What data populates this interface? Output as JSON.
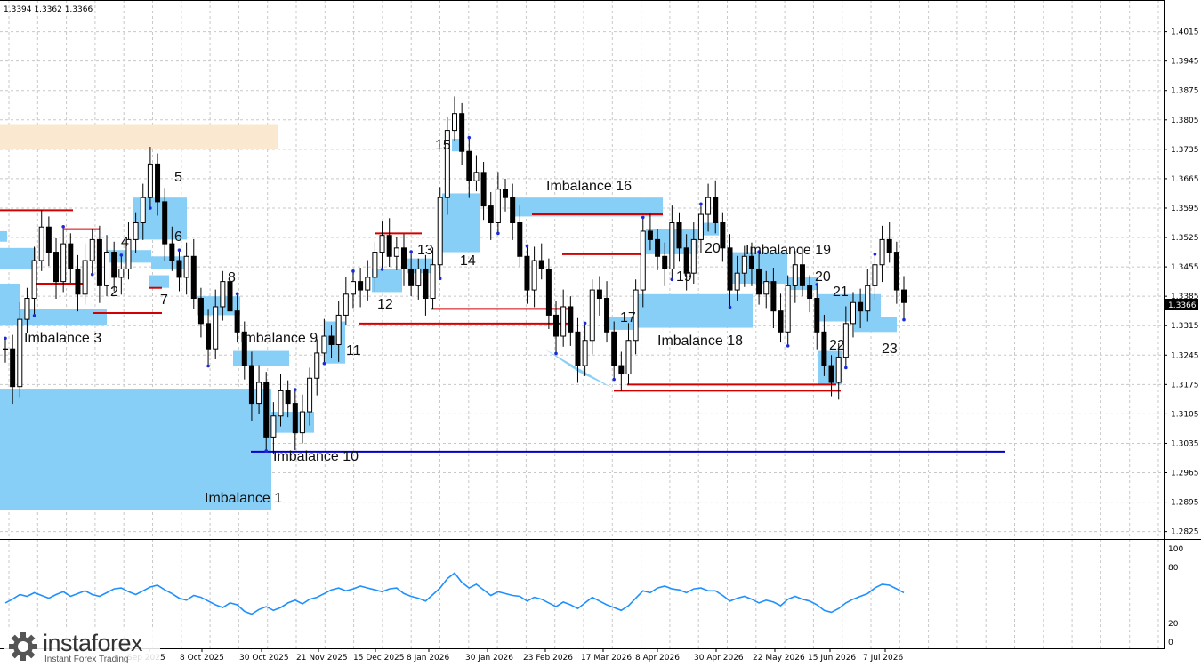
{
  "header": {
    "ohlc": "1.3394 1.3362 1.3366"
  },
  "brand": {
    "name": "instaforex",
    "tagline": "Instant Forex Trading"
  },
  "colors": {
    "imbalance_zone": "#88cff7",
    "supply_zone": "#fbe8d1",
    "level_red": "#d40000",
    "level_blue": "#0000cc",
    "candle": "#000000",
    "marker": "#1a2ad8",
    "indicator": "#1e90ff",
    "current_price_tag": "#000000"
  },
  "chart_data": [
    {
      "type": "candlestick",
      "title": "",
      "symbol": "",
      "ylim": [
        1.282,
        1.4065
      ],
      "y_ticks": [
        "1.4015",
        "1.3945",
        "1.3875",
        "1.3805",
        "1.3735",
        "1.3665",
        "1.3595",
        "1.3525",
        "1.3455",
        "1.3385",
        "1.3315",
        "1.3245",
        "1.3175",
        "1.3105",
        "1.3035",
        "1.2965",
        "1.2895",
        "1.2825"
      ],
      "x_ticks": [
        "Sep 2025",
        "8 Oct 2025",
        "30 Oct 2025",
        "21 Nov 2025",
        "15 Dec 2025",
        "8 Jan 2026",
        "30 Jan 2026",
        "23 Feb 2026",
        "17 Mar 2026",
        "8 Apr 2026",
        "30 Apr 2026",
        "22 May 2026",
        "15 Jun 2026",
        "7 Jul 2026"
      ],
      "current_price": "1.3366",
      "close_path": [
        1.326,
        1.317,
        1.333,
        1.338,
        1.347,
        1.355,
        1.349,
        1.342,
        1.351,
        1.345,
        1.339,
        1.347,
        1.352,
        1.341,
        1.349,
        1.343,
        1.345,
        1.352,
        1.356,
        1.362,
        1.37,
        1.361,
        1.351,
        1.347,
        1.343,
        1.348,
        1.338,
        1.332,
        1.326,
        1.336,
        1.342,
        1.335,
        1.33,
        1.322,
        1.313,
        1.318,
        1.305,
        1.31,
        1.316,
        1.313,
        1.306,
        1.311,
        1.319,
        1.325,
        1.329,
        1.327,
        1.334,
        1.339,
        1.342,
        1.34,
        1.343,
        1.349,
        1.353,
        1.348,
        1.35,
        1.345,
        1.341,
        1.345,
        1.338,
        1.346,
        1.362,
        1.378,
        1.382,
        1.373,
        1.366,
        1.368,
        1.36,
        1.356,
        1.364,
        1.362,
        1.356,
        1.348,
        1.34,
        1.347,
        1.345,
        1.334,
        1.329,
        1.336,
        1.33,
        1.322,
        1.328,
        1.34,
        1.338,
        1.33,
        1.322,
        1.32,
        1.328,
        1.34,
        1.354,
        1.352,
        1.348,
        1.345,
        1.356,
        1.35,
        1.344,
        1.352,
        1.358,
        1.362,
        1.356,
        1.35,
        1.34,
        1.344,
        1.348,
        1.345,
        1.339,
        1.342,
        1.335,
        1.33,
        1.341,
        1.346,
        1.341,
        1.338,
        1.33,
        1.322,
        1.318,
        1.324,
        1.332,
        1.337,
        1.335,
        1.341,
        1.346,
        1.352,
        1.349,
        1.34,
        1.337
      ],
      "zones": [
        {
          "label": "Imbalance 1",
          "low": 1.2875,
          "high": 1.3165,
          "start": "",
          "end": "30 Oct 2025"
        },
        {
          "label": "2",
          "low": 1.3355,
          "high": 1.3415,
          "start": "",
          "end": ""
        },
        {
          "label": "Imbalance 3",
          "low": 1.3315,
          "high": 1.3355,
          "start": "",
          "end": ""
        },
        {
          "label": "4",
          "low": 1.3465,
          "high": 1.3495,
          "start": "",
          "end": ""
        },
        {
          "label": "5",
          "low": 1.352,
          "high": 1.362,
          "start": "",
          "end": "8 Oct 2025"
        },
        {
          "label": "6",
          "low": 1.345,
          "high": 1.348,
          "start": "",
          "end": "8 Oct 2025"
        },
        {
          "label": "7",
          "low": 1.3405,
          "high": 1.3435,
          "start": "",
          "end": ""
        },
        {
          "label": "8",
          "low": 1.334,
          "high": 1.3385,
          "start": "8 Oct 2025",
          "end": ""
        },
        {
          "label": "Imbalance 9",
          "low": 1.322,
          "high": 1.3255,
          "start": "30 Oct 2025",
          "end": "21 Nov 2025"
        },
        {
          "label": "Imbalance 10",
          "low": 1.306,
          "high": 1.311,
          "start": "30 Oct 2025",
          "end": "21 Nov 2025"
        },
        {
          "label": "11",
          "low": 1.3225,
          "high": 1.3325,
          "start": "21 Nov 2025",
          "end": ""
        },
        {
          "label": "12",
          "low": 1.3395,
          "high": 1.345,
          "start": "15 Dec 2025",
          "end": ""
        },
        {
          "label": "13",
          "low": 1.344,
          "high": 1.3475,
          "start": "8 Jan 2026",
          "end": ""
        },
        {
          "label": "14",
          "low": 1.349,
          "high": 1.363,
          "start": "",
          "end": "30 Jan 2026"
        },
        {
          "label": "15",
          "low": 1.373,
          "high": 1.376,
          "start": "",
          "end": ""
        },
        {
          "label": "Imbalance 16",
          "low": 1.3575,
          "high": 1.362,
          "start": "",
          "end": "8 Apr 2026"
        },
        {
          "label": "17",
          "low": 1.3305,
          "high": 1.3335,
          "start": "",
          "end": ""
        },
        {
          "label": "Imbalance 18",
          "low": 1.331,
          "high": 1.339,
          "start": "8 Apr 2026",
          "end": "22 May 2026"
        },
        {
          "label": "19",
          "low": 1.3485,
          "high": 1.3545,
          "start": "8 Apr 2026",
          "end": ""
        },
        {
          "label": "Imbalance 19",
          "low": 1.3415,
          "high": 1.349,
          "start": "22 May 2026",
          "end": ""
        },
        {
          "label": "20",
          "low": 1.353,
          "high": 1.356,
          "start": "",
          "end": ""
        },
        {
          "label": "20",
          "low": 1.34,
          "high": 1.343,
          "start": "",
          "end": ""
        },
        {
          "label": "21",
          "low": 1.3325,
          "high": 1.339,
          "start": "15 Jun 2026",
          "end": ""
        },
        {
          "label": "22",
          "low": 1.3175,
          "high": 1.3255,
          "start": "15 Jun 2026",
          "end": ""
        },
        {
          "label": "23",
          "low": 1.33,
          "high": 1.3335,
          "start": "",
          "end": "7 Jul 2026"
        }
      ],
      "supply_zone": {
        "low": 1.3735,
        "high": 1.3795
      },
      "levels_red": [
        1.359,
        1.3415,
        1.3545,
        1.3345,
        1.3405,
        1.3535,
        1.3355,
        1.332,
        1.358,
        1.3485,
        1.3175,
        1.316
      ],
      "level_blue": 1.3015,
      "oscillator": {
        "ylim": [
          0,
          100
        ],
        "ticks": [
          "100",
          "80",
          "20",
          "0"
        ],
        "values": [
          42,
          46,
          51,
          49,
          53,
          50,
          47,
          51,
          54,
          49,
          52,
          55,
          51,
          49,
          53,
          57,
          58,
          54,
          51,
          55,
          59,
          61,
          56,
          52,
          47,
          45,
          50,
          48,
          44,
          40,
          37,
          42,
          40,
          33,
          30,
          35,
          38,
          34,
          37,
          42,
          45,
          41,
          46,
          48,
          52,
          56,
          58,
          55,
          57,
          60,
          58,
          56,
          54,
          57,
          58,
          52,
          49,
          47,
          44,
          51,
          58,
          68,
          74,
          64,
          58,
          62,
          56,
          50,
          54,
          52,
          50,
          49,
          44,
          48,
          46,
          42,
          38,
          43,
          40,
          36,
          42,
          48,
          44,
          40,
          37,
          34,
          39,
          47,
          55,
          53,
          58,
          60,
          57,
          56,
          53,
          57,
          58,
          55,
          55,
          50,
          44,
          47,
          49,
          46,
          42,
          45,
          43,
          39,
          46,
          49,
          46,
          44,
          40,
          34,
          32,
          36,
          42,
          46,
          49,
          52,
          58,
          62,
          61,
          57,
          53
        ]
      }
    }
  ],
  "annotation_labels": {
    "z1": "Imbalance 1",
    "z2": "2",
    "z3": "Imbalance 3",
    "z4": "4",
    "z5": "5",
    "z6": "6",
    "z7": "7",
    "z8": "8",
    "z9": "Imbalance 9",
    "z10": "Imbalance 10",
    "z11": "11",
    "z12": "12",
    "z13": "13",
    "z14": "14",
    "z15": "15",
    "z16": "Imbalance 16",
    "z17": "17",
    "z18": "Imbalance 18",
    "z19a": "19",
    "z19b": "Imbalance 19",
    "z20a": "20",
    "z20b": "20",
    "z21": "21",
    "z22": "22",
    "z23": "23"
  }
}
